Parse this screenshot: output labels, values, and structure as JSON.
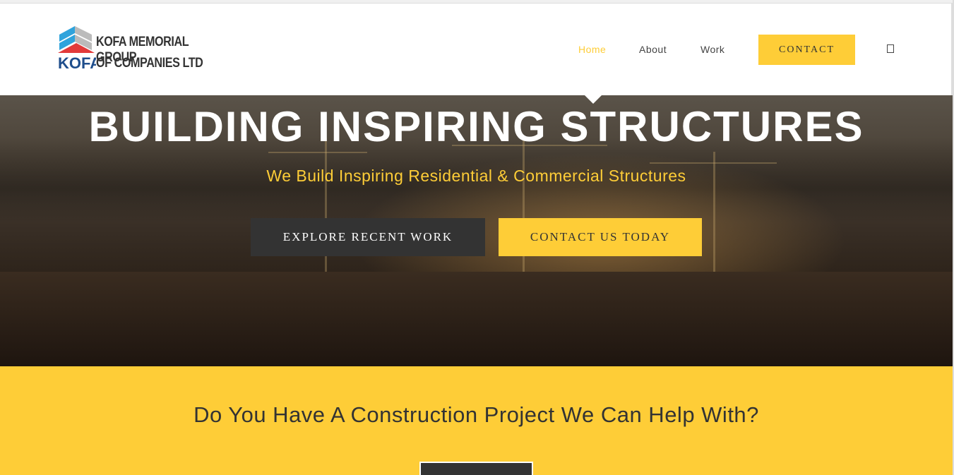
{
  "header": {
    "logo": {
      "line1": "KOFA MEMORIAL GROUP",
      "line2": "OF COMPANIES LTD",
      "mark": "KOFA"
    },
    "nav": [
      {
        "label": "Home",
        "active": true
      },
      {
        "label": "About"
      },
      {
        "label": "Work"
      }
    ],
    "contact_label": "CONTACT",
    "search_icon": "search-icon"
  },
  "hero": {
    "title": "BUILDING INSPIRING STRUCTURES",
    "subtitle": "We Build Inspiring Residential & Commercial Structures",
    "explore_label": "EXPLORE RECENT WORK",
    "contact_today_label": "CONTACT US TODAY"
  },
  "cta": {
    "heading": "Do You Have A Construction Project We Can Help With?"
  },
  "colors": {
    "accent": "#fecd37",
    "dark": "#333333"
  }
}
